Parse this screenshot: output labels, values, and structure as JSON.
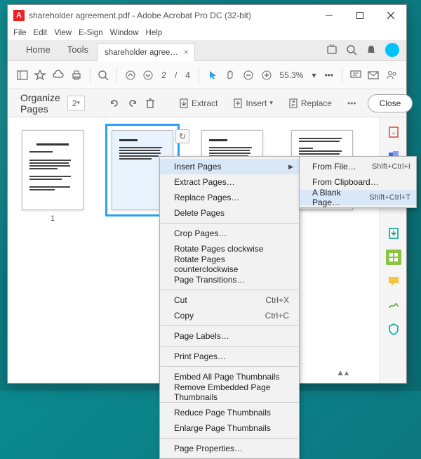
{
  "window": {
    "title": "shareholder agreement.pdf - Adobe Acrobat Pro DC (32-bit)",
    "app_badge": "A"
  },
  "menubar": [
    "File",
    "Edit",
    "View",
    "E-Sign",
    "Window",
    "Help"
  ],
  "tabs": {
    "home": "Home",
    "tools": "Tools",
    "file_tab": "shareholder agree…"
  },
  "toolbar": {
    "page_current": "2",
    "page_sep": "/",
    "page_total": "4",
    "zoom": "55.3%",
    "zoom_caret": "▾",
    "dots": "•••"
  },
  "organize": {
    "title": "Organize Pages",
    "page_field": "2",
    "extract": "Extract",
    "insert": "Insert",
    "insert_caret": "▾",
    "replace": "Replace",
    "dots": "•••",
    "close": "Close"
  },
  "thumbs": {
    "p1": "1"
  },
  "context_menu": {
    "insert_pages": "Insert Pages",
    "extract_pages": "Extract Pages…",
    "replace_pages": "Replace Pages…",
    "delete_pages": "Delete Pages",
    "crop_pages": "Crop Pages…",
    "rotate_cw": "Rotate Pages clockwise",
    "rotate_ccw": "Rotate Pages counterclockwise",
    "transitions": "Page Transitions…",
    "cut": "Cut",
    "cut_sc": "Ctrl+X",
    "copy": "Copy",
    "copy_sc": "Ctrl+C",
    "page_labels": "Page Labels…",
    "print_pages": "Print Pages…",
    "embed_thumbs": "Embed All Page Thumbnails",
    "remove_thumbs": "Remove Embedded Page Thumbnails",
    "reduce_thumbs": "Reduce Page Thumbnails",
    "enlarge_thumbs": "Enlarge Page Thumbnails",
    "page_props": "Page Properties…"
  },
  "submenu": {
    "from_file": "From File…",
    "from_file_sc": "Shift+Ctrl+I",
    "from_clipboard": "From Clipboard…",
    "blank_page": "A Blank Page…",
    "blank_page_sc": "Shift+Ctrl+T"
  }
}
